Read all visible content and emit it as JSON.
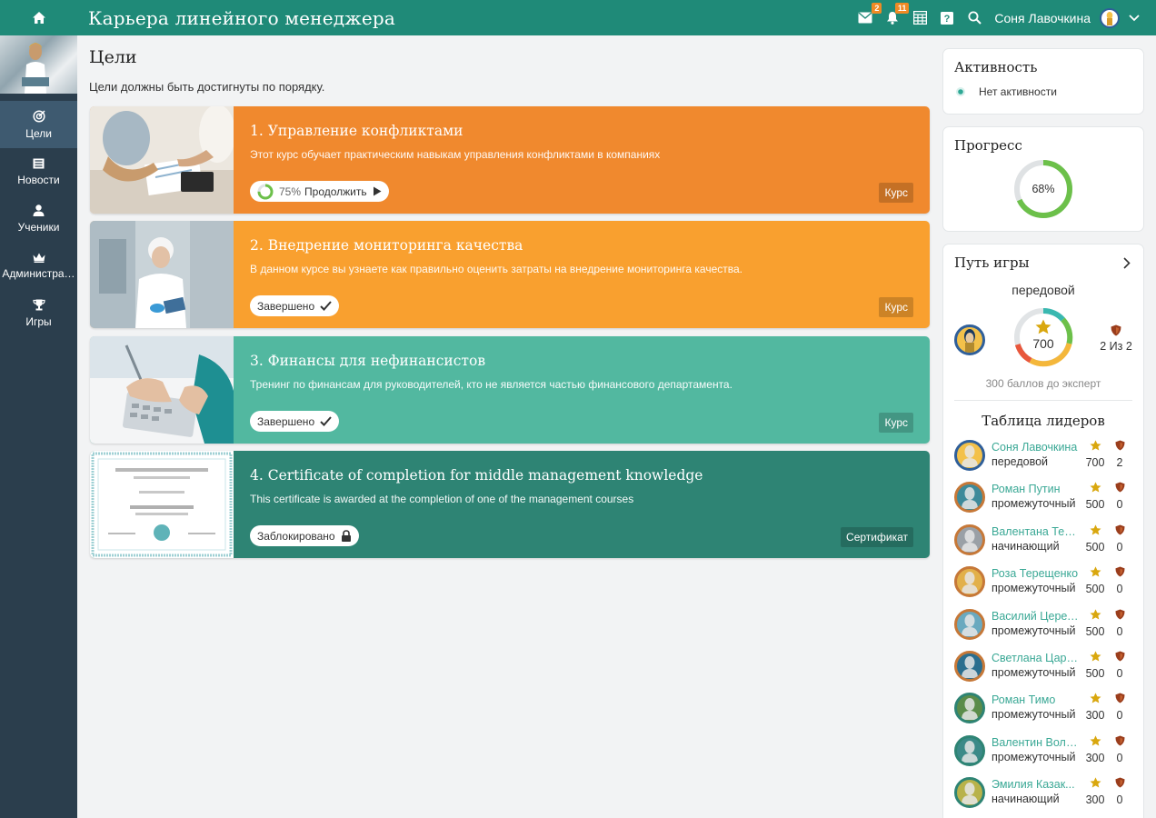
{
  "app": {
    "title": "Карьера линейного менеджера",
    "notifications": {
      "messages_count": "2",
      "alerts_count": "11"
    },
    "user_name": "Соня Лавочкина"
  },
  "sidebar": {
    "items": [
      {
        "label": "Цели",
        "icon": "target-icon",
        "active": true
      },
      {
        "label": "Новости",
        "icon": "news-icon",
        "active": false
      },
      {
        "label": "Ученики",
        "icon": "user-icon",
        "active": false
      },
      {
        "label": "Администра…",
        "icon": "crown-icon",
        "active": false
      },
      {
        "label": "Игры",
        "icon": "trophy-icon",
        "active": false
      }
    ]
  },
  "main": {
    "title": "Цели",
    "subtitle": "Цели должны быть достигнуты по порядку.",
    "goals": [
      {
        "title": "1. Управление конфликтами",
        "description": "Этот курс обучает практическим навыкам управления конфликтами в компаниях",
        "progress_label": "75%",
        "action_label": "Продолжить",
        "type": "Курс",
        "color": "#f0892e"
      },
      {
        "title": "2. Внедрение мониторинга качества",
        "description": "В данном курсе вы узнаете как правильно оценить затраты на внедрение мониторинга качества.",
        "status": "Завершено",
        "type": "Курс",
        "color": "#f9a02f"
      },
      {
        "title": "3. Финансы для нефинансистов",
        "description": "Тренинг по финансам для руководителей, кто не является частью финансового департамента.",
        "status": "Завершено",
        "type": "Курс",
        "color": "#52b8a0"
      },
      {
        "title": "4. Certificate of completion for middle management knowledge",
        "description": "This certificate is awarded at the completion of one of the management courses",
        "status": "Заблокировано",
        "type": "Сертификат",
        "color": "#2e8474"
      }
    ]
  },
  "activity": {
    "title": "Активность",
    "status": "Нет активности"
  },
  "progress": {
    "title": "Прогресс",
    "value_label": "68%",
    "value": 0.68
  },
  "game_path": {
    "title": "Путь игры",
    "level": "передовой",
    "points": "700",
    "badges": "2 Из 2",
    "to_next": "300 баллов до эксперт",
    "leaderboard_title": "Таблица лидеров",
    "leaders": [
      {
        "name": "Соня Лавочкина",
        "level": "передовой",
        "points": "700",
        "badges": "2",
        "ring": "#2f5f9a",
        "bg": "#f3c14a"
      },
      {
        "name": "Роман Путин",
        "level": "промежуточный",
        "points": "500",
        "badges": "0",
        "ring": "#c67838",
        "bg": "#3d8a9a"
      },
      {
        "name": "Валентана Тер...",
        "level": "начинающий",
        "points": "500",
        "badges": "0",
        "ring": "#c67838",
        "bg": "#9aa0a6"
      },
      {
        "name": "Роза Терещенко",
        "level": "промежуточный",
        "points": "500",
        "badges": "0",
        "ring": "#c67838",
        "bg": "#e2b04a"
      },
      {
        "name": "Василий Церет...",
        "level": "промежуточный",
        "points": "500",
        "badges": "0",
        "ring": "#c67838",
        "bg": "#6aa9bf"
      },
      {
        "name": "Светлана Царе...",
        "level": "промежуточный",
        "points": "500",
        "badges": "0",
        "ring": "#c67838",
        "bg": "#2a6e8f"
      },
      {
        "name": "Роман Тимо",
        "level": "промежуточный",
        "points": "300",
        "badges": "0",
        "ring": "#2e8474",
        "bg": "#5b8c4a"
      },
      {
        "name": "Валентин Воло...",
        "level": "промежуточный",
        "points": "300",
        "badges": "0",
        "ring": "#2e8474",
        "bg": "#3b8a88"
      },
      {
        "name": "Эмилия Казак...",
        "level": "начинающий",
        "points": "300",
        "badges": "0",
        "ring": "#2e8474",
        "bg": "#b8b24a"
      }
    ]
  }
}
